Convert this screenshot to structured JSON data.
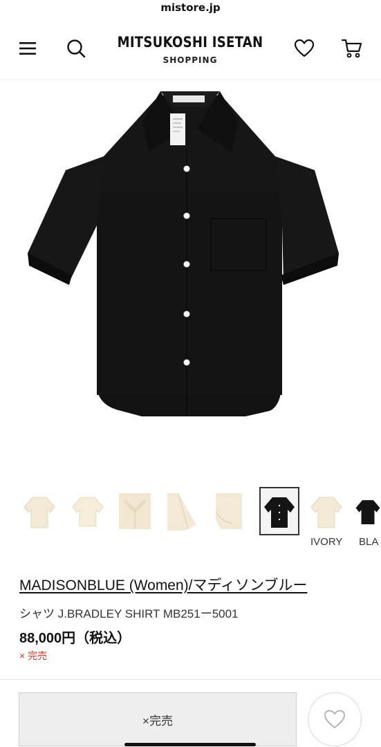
{
  "browser": {
    "url": "mistore.jp"
  },
  "header": {
    "logo_main": "MITSUKOSHI ISETAN",
    "logo_sub": "SHOPPING",
    "icons": [
      "menu-icon",
      "search-icon",
      "heart-icon",
      "cart-icon"
    ]
  },
  "gallery": {
    "color_labels": [
      "IVORY",
      "BLA"
    ],
    "thumbnail_colors": [
      "ivory",
      "ivory",
      "ivory",
      "ivory",
      "ivory",
      "black",
      "ivory",
      "black"
    ],
    "selected_thumbnail": 6
  },
  "product": {
    "brand": "MADISONBLUE (Women)/マディソンブルー",
    "name": "シャツ J.BRADLEY SHIRT MB251ー5001",
    "price": "88,000円（税込）",
    "stock_status": "× 完売"
  },
  "action_bar": {
    "soldout_label": "×完売"
  },
  "colors": {
    "sold_out_red": "#c0392b",
    "shirt_black": "#141414",
    "shirt_ivory": "#f3ead6"
  }
}
